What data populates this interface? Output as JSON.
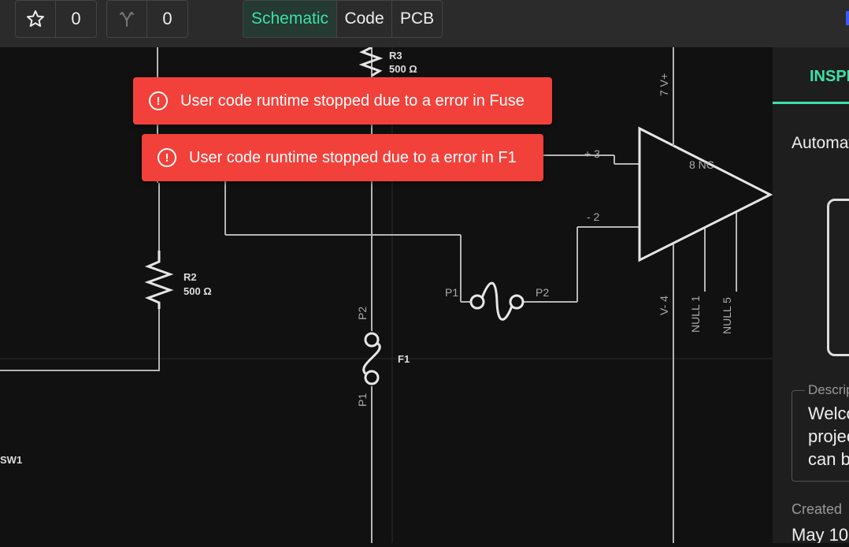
{
  "toolbar": {
    "star_count": "0",
    "fork_count": "0",
    "tabs": [
      {
        "label": "Schematic",
        "active": true
      },
      {
        "label": "Code",
        "active": false
      },
      {
        "label": "PCB",
        "active": false
      }
    ]
  },
  "colors": {
    "accent": "#3ee0a5",
    "error": "#f2413a",
    "wire": "#b5b5b5",
    "background": "#111111",
    "panel": "#1e1e1e",
    "toolbar": "#2b2b2b"
  },
  "toasts": [
    {
      "icon": "error-icon",
      "message": "User code runtime stopped due to a error in Fuse"
    },
    {
      "icon": "error-icon",
      "message": "User code runtime stopped due to a error in F1"
    }
  ],
  "schematic": {
    "r3": {
      "name": "R3",
      "value": "500 Ω"
    },
    "r2": {
      "name": "R2",
      "value": "500 Ω"
    },
    "f1": {
      "name": "F1",
      "pin1": "P1",
      "pin2": "P2"
    },
    "fuse": {
      "pin1": "P1",
      "pin2": "P2"
    },
    "sw1": {
      "name": "SW1"
    },
    "opamp": {
      "vplus": "7  V+",
      "in_plus": "+  3",
      "in_minus": "-  2",
      "nc": "8  NC",
      "vminus": "V-  4",
      "null1": "NULL  1",
      "null5": "NULL  5"
    }
  },
  "panel": {
    "tab_label": "INSPECT",
    "automatic_label": "Automatic",
    "description_label": "Description",
    "description_text": "Welcome to your\nproject! You\ncan build",
    "created_label": "Created",
    "created_value": "May 10"
  }
}
